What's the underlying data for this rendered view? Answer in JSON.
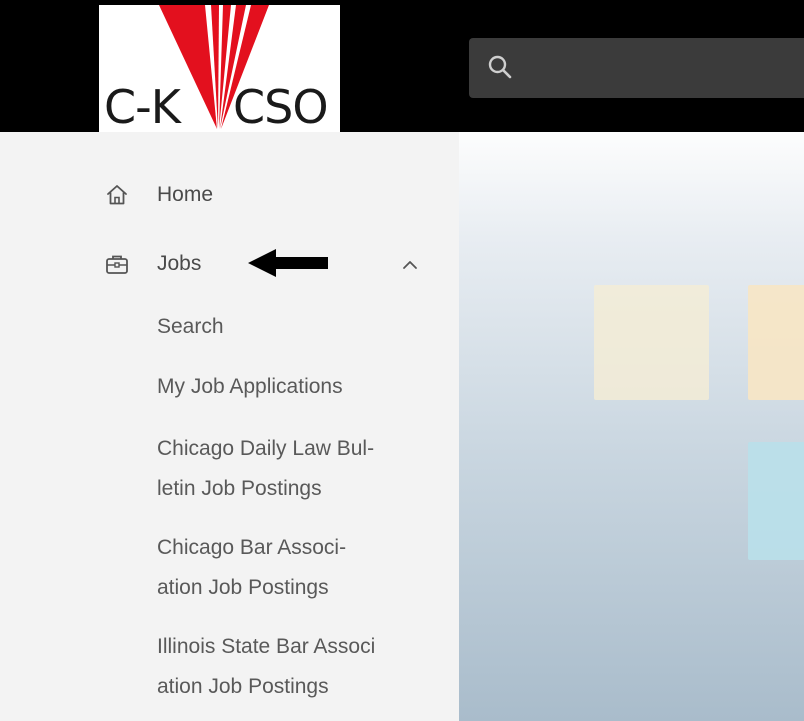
{
  "header": {
    "logo": {
      "left_text": "C-K",
      "right_text": "CSO"
    },
    "search": {
      "placeholder": "",
      "value": ""
    },
    "icons": {
      "search": "search-icon"
    }
  },
  "sidebar": {
    "items": [
      {
        "label": "Home",
        "icon": "home-icon"
      },
      {
        "label": "Jobs",
        "icon": "briefcase-icon",
        "expanded": true
      }
    ],
    "jobs_subitems": [
      {
        "lines": [
          "Search"
        ]
      },
      {
        "lines": [
          "My Job Applications"
        ]
      },
      {
        "lines": [
          "Chicago Daily Law Bul-",
          "letin Job Postings"
        ]
      },
      {
        "lines": [
          "Chicago Bar Associ-",
          "ation Job Postings"
        ]
      },
      {
        "lines": [
          "Illinois State Bar Associ",
          "ation Job Postings"
        ]
      }
    ]
  },
  "annotation": {
    "icon": "left-arrow-icon"
  },
  "colors": {
    "topbar": "#000000",
    "logo_red": "#e3101e",
    "sidebar_bg": "#f3f3f3",
    "text": "#4a4a4a",
    "search_bg": "#3b3b3b"
  }
}
